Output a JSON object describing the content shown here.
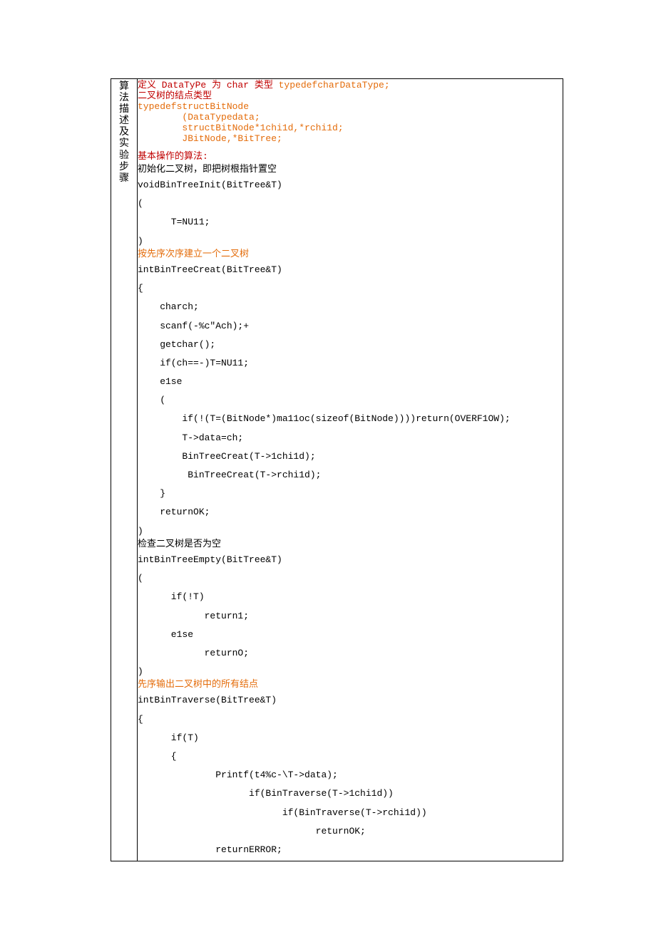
{
  "sidebar": {
    "title": "算法描述及实验步骤"
  },
  "l1a": "定义 DataTyPe 为 char 类型 ",
  "l1b": "typedefcharDataType;",
  "l2": "二叉树的结点类型",
  "l3": "typedefstructBitNode",
  "l4": "        (DataTypedata;",
  "l5": "        structBitNode*1chi1d,*rchi1d;",
  "l6": "        JBitNode,*BitTree;",
  "l7": "基本操作的算法:",
  "l8": "初始化二叉树，即把树根指针置空",
  "l9": "voidBinTreeInit(BitTree&T)",
  "l10": "(",
  "l11": "      T=NU11;",
  "l12": ")",
  "l13": "按先序次序建立一个二叉树",
  "l14": "intBinTreeCreat(BitTree&T)",
  "l15": "{",
  "l16": "    charch;",
  "l17": "    scanf(-%c\"Ach);+",
  "l18": "    getchar();",
  "l19": "    if(ch==-)T=NU11;",
  "l20": "    e1se",
  "l21": "    (",
  "l22": "        if(!(T=(BitNode*)ma11oc(sizeof(BitNode))))return(OVERF1OW);",
  "l23": "        T->data=ch;",
  "l24": "        BinTreeCreat(T->1chi1d);",
  "l25": "         BinTreeCreat(T->rchi1d);",
  "l26": "    }",
  "l27": "    returnOK;",
  "l28": ")",
  "l29": "检查二叉树是否为空",
  "l30": "intBinTreeEmpty(BitTree&T)",
  "l31": "(",
  "l32": "      if(!T)",
  "l33": "            return1;",
  "l34": "      e1se",
  "l35": "            returnO;",
  "l36": ")",
  "l37": "先序输出二叉树中的所有结点",
  "l38": "intBinTraverse(BitTree&T)",
  "l39": "{",
  "l40": "      if(T)",
  "l41": "      {",
  "l42": "              Printf(t4%c-\\T->data);",
  "l43": "                    if(BinTraverse(T->1chi1d))",
  "l44": "                          if(BinTraverse(T->rchi1d))",
  "l45": "                                returnOK;",
  "l46": "              returnERROR;"
}
